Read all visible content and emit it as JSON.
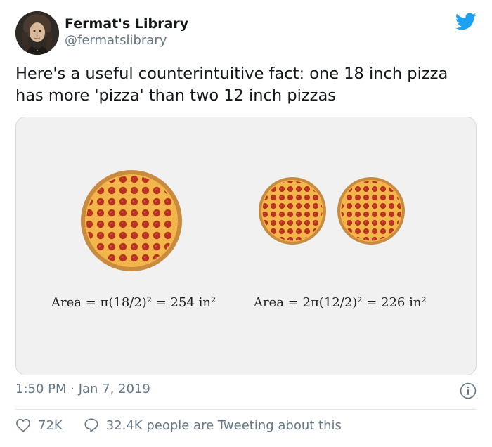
{
  "author": {
    "display_name": "Fermat's Library",
    "handle": "@fermatslibrary",
    "avatar_icon": "portrait-avatar"
  },
  "brand": {
    "icon": "twitter-bird-icon",
    "color": "#1da1f2"
  },
  "tweet": {
    "text": "Here's a useful counterintuitive fact: one 18 inch pizza has more 'pizza' than two 12 inch pizzas"
  },
  "media": {
    "left_formula": "Area = π(18/2)² = 254 in²",
    "right_formula": "Area = 2π(12/2)² = 226 in²"
  },
  "meta": {
    "timestamp": "1:50 PM · Jan 7, 2019",
    "info_icon": "info-icon"
  },
  "actions": {
    "likes": "72K",
    "tweeting": "32.4K people are Tweeting about this"
  }
}
